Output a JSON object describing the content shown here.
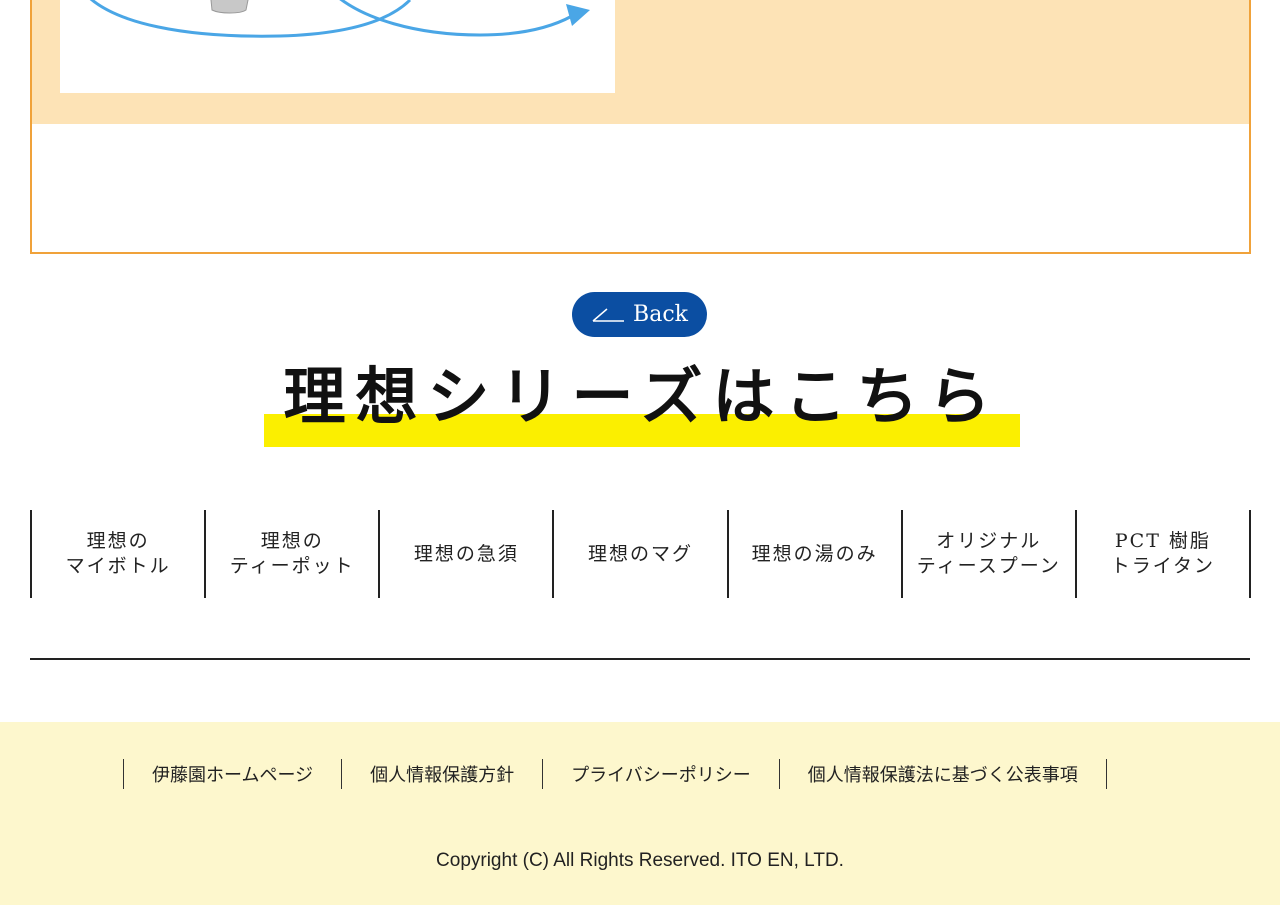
{
  "back_button": {
    "label": "Back",
    "icon": "back-arrow-icon"
  },
  "series": {
    "heading": "理想シリーズはこちら",
    "items": [
      {
        "label": "理想の\nマイボトル"
      },
      {
        "label": "理想の\nティーポット"
      },
      {
        "label": "理想の急須"
      },
      {
        "label": "理想のマグ"
      },
      {
        "label": "理想の湯のみ"
      },
      {
        "label": "オリジナル\nティースプーン"
      },
      {
        "label": "PCT 樹脂\nトライタン"
      }
    ]
  },
  "footer": {
    "links": [
      {
        "label": "伊藤園ホームページ"
      },
      {
        "label": "個人情報保護方針"
      },
      {
        "label": "プライバシーポリシー"
      },
      {
        "label": "個人情報保護法に基づく公表事項"
      }
    ],
    "copyright": "Copyright (C) All Rights Reserved. ITO EN, LTD."
  },
  "colors": {
    "frame_border": "#f0a23a",
    "peach_bg": "#fde3b6",
    "back_button_bg": "#0b4ea2",
    "highlight": "#fbef00",
    "footer_bg": "#fdf7cd",
    "arrow_blue": "#4aa6e6"
  }
}
